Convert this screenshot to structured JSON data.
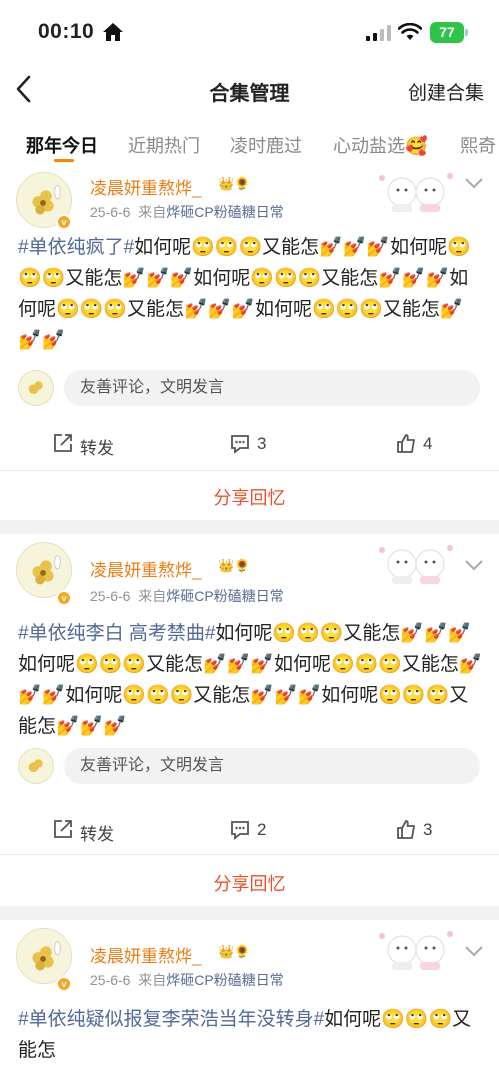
{
  "status": {
    "time": "00:10",
    "battery": "77"
  },
  "nav": {
    "title": "合集管理",
    "create_label": "创建合集"
  },
  "tabs": [
    "那年今日",
    "近期热门",
    "凌时鹿过",
    "心动盐选🥰",
    "熙奇"
  ],
  "posts": [
    {
      "username": "凌晨妍重熬烨_",
      "crown": "👑🌻",
      "date": "25-6-6",
      "from_label": "来自",
      "source": "烨砸CP粉磕糖日常",
      "tag": "#单依纯疯了#",
      "body": "如何呢🙄🙄🙄又能怎💅💅💅如何呢🙄🙄🙄又能怎💅💅💅如何呢🙄🙄🙄又能怎💅💅💅如何呢🙄🙄🙄又能怎💅💅💅如何呢🙄🙄🙄又能怎💅💅💅",
      "comment_placeholder": "友善评论，文明发言",
      "repost_label": "转发",
      "comments": "3",
      "likes": "4",
      "share_label": "分享回忆"
    },
    {
      "username": "凌晨妍重熬烨_",
      "crown": "👑🌻",
      "date": "25-6-6",
      "from_label": "来自",
      "source": "烨砸CP粉磕糖日常",
      "tag": "#单依纯李白 高考禁曲#",
      "body": "如何呢🙄🙄🙄又能怎💅💅💅如何呢🙄🙄🙄又能怎💅💅💅如何呢🙄🙄🙄又能怎💅💅💅如何呢🙄🙄🙄又能怎💅💅💅如何呢🙄🙄🙄又能怎💅💅💅",
      "comment_placeholder": "友善评论，文明发言",
      "repost_label": "转发",
      "comments": "2",
      "likes": "3",
      "share_label": "分享回忆"
    },
    {
      "username": "凌晨妍重熬烨_",
      "crown": "👑🌻",
      "date": "25-6-6",
      "from_label": "来自",
      "source": "烨砸CP粉磕糖日常",
      "tag": "#单依纯疑似报复李荣浩当年没转身#",
      "body": "如何呢🙄🙄🙄又能怎"
    }
  ],
  "colors": {
    "username": "#f07c13",
    "tag": "#53699a",
    "share": "#e8512b",
    "tab_indicator": "#ff8200",
    "battery": "#30c34a"
  }
}
